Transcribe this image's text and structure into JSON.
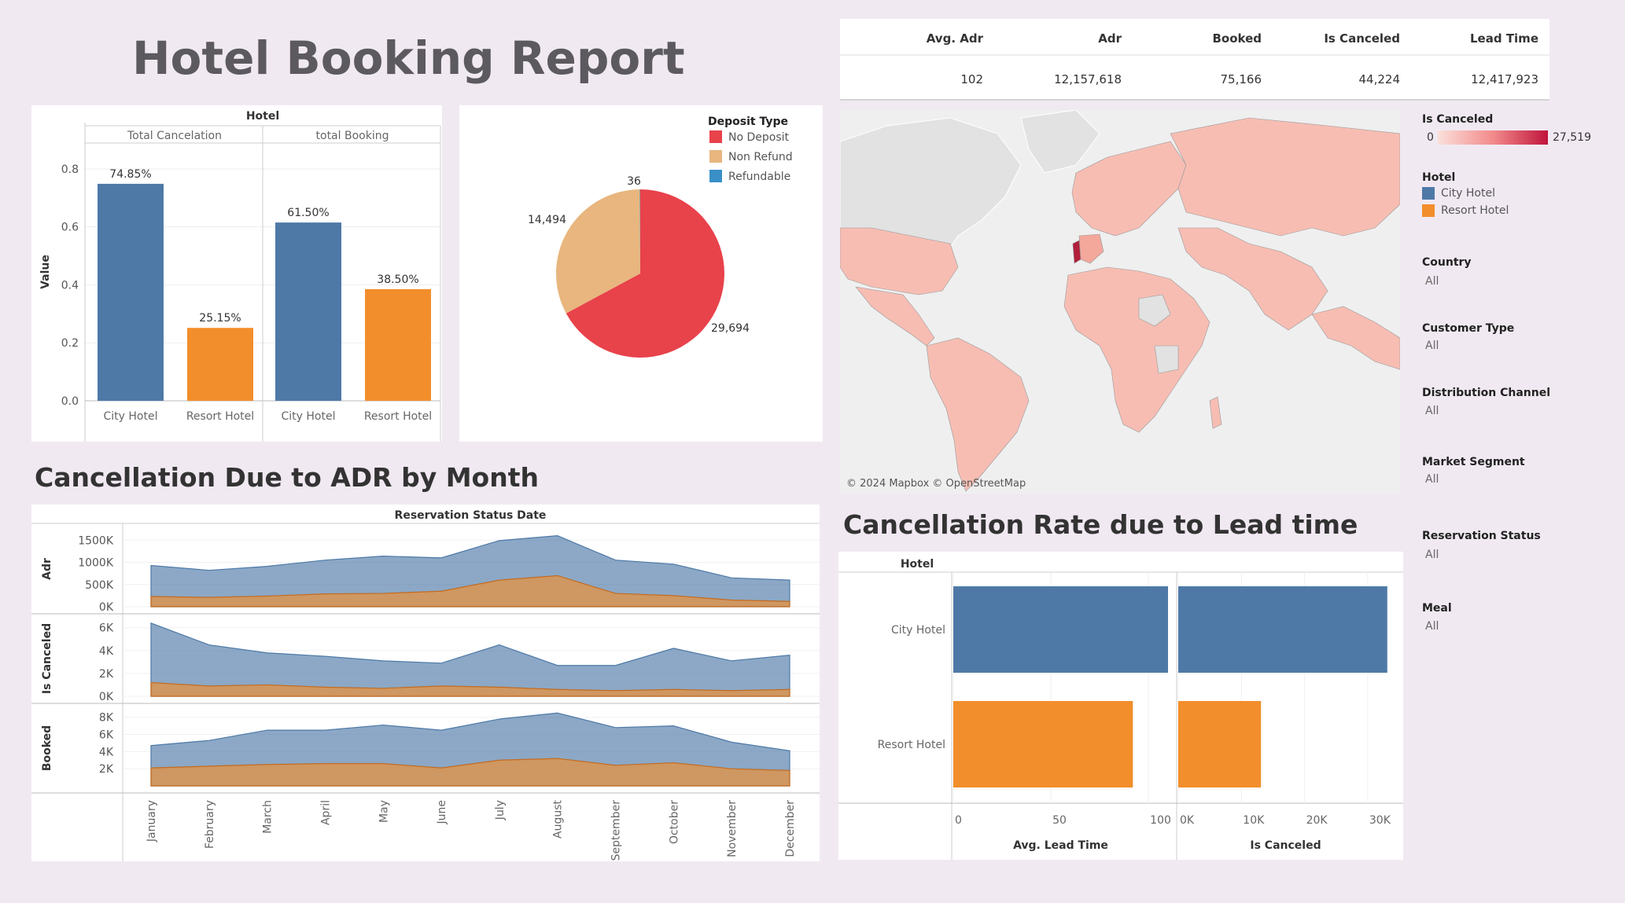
{
  "page_title": "Hotel Booking Report",
  "sections": {
    "adr_title": "Cancellation Due to ADR by Month",
    "lead_title": "Cancellation Rate due to Lead time"
  },
  "colors": {
    "city": "#4e79a7",
    "resort": "#f28e2b",
    "no_deposit": "#e8424b",
    "non_refund": "#e8b67e",
    "refundable": "#3a8fc6",
    "background": "#f1e9f2"
  },
  "kpi": {
    "headers": [
      "Avg. Adr",
      "Adr",
      "Booked",
      "Is Canceled",
      "Lead Time"
    ],
    "values": [
      "102",
      "12,157,618",
      "75,166",
      "44,224",
      "12,417,923"
    ]
  },
  "map": {
    "credit": "© 2024 Mapbox © OpenStreetMap",
    "legend_title": "Is Canceled",
    "legend_min": "0",
    "legend_max": "27,519"
  },
  "hotel_legend": {
    "title": "Hotel",
    "items": [
      "City Hotel",
      "Resort Hotel"
    ]
  },
  "filters": [
    {
      "label": "Country",
      "value": "All"
    },
    {
      "label": "Customer Type",
      "value": "All"
    },
    {
      "label": "Distribution Channel",
      "value": "All"
    },
    {
      "label": "Market Segment",
      "value": "All"
    },
    {
      "label": "Reservation Status",
      "value": "All"
    },
    {
      "label": "Meal",
      "value": "All"
    }
  ],
  "chart_data": [
    {
      "id": "hotel_bars",
      "type": "bar",
      "title": "Hotel",
      "ylabel": "Value",
      "ylim": [
        0,
        0.9
      ],
      "yticks": [
        "0.8",
        "0.6",
        "0.4",
        "0.2",
        "0.0"
      ],
      "panels": [
        {
          "name": "Total Cancelation",
          "categories": [
            "City Hotel",
            "Resort Hotel"
          ],
          "values": [
            0.7485,
            0.2515
          ],
          "labels": [
            "74.85%",
            "25.15%"
          ]
        },
        {
          "name": "total Booking",
          "categories": [
            "City Hotel",
            "Resort Hotel"
          ],
          "values": [
            0.615,
            0.385
          ],
          "labels": [
            "61.50%",
            "38.50%"
          ]
        }
      ]
    },
    {
      "id": "deposit_pie",
      "type": "pie",
      "legend_title": "Deposit Type",
      "categories": [
        "No Deposit",
        "Non Refund",
        "Refundable"
      ],
      "values": [
        29694,
        14494,
        36
      ],
      "labels": [
        "29,694",
        "14,494",
        "36"
      ]
    },
    {
      "id": "monthly_area",
      "type": "area",
      "title": "Reservation Status Date",
      "categories": [
        "January",
        "February",
        "March",
        "April",
        "May",
        "June",
        "July",
        "August",
        "September",
        "October",
        "November",
        "December"
      ],
      "rows": [
        {
          "name": "Adr",
          "ylim": [
            0,
            1700000
          ],
          "yticks": [
            [
              0,
              "0K"
            ],
            [
              500000,
              "500K"
            ],
            [
              1000000,
              "1000K"
            ],
            [
              1500000,
              "1500K"
            ]
          ],
          "city": [
            930000,
            820000,
            910000,
            1050000,
            1140000,
            1100000,
            1490000,
            1600000,
            1050000,
            960000,
            650000,
            600000
          ],
          "resort": [
            230000,
            210000,
            240000,
            290000,
            300000,
            350000,
            600000,
            700000,
            300000,
            250000,
            150000,
            120000
          ]
        },
        {
          "name": "Is Canceled",
          "ylim": [
            0,
            6600
          ],
          "yticks": [
            [
              0,
              "0K"
            ],
            [
              2000,
              "2K"
            ],
            [
              4000,
              "4K"
            ],
            [
              6000,
              "6K"
            ]
          ],
          "city": [
            6400,
            4500,
            3800,
            3500,
            3100,
            2900,
            4500,
            2700,
            2700,
            4200,
            3100,
            3600
          ],
          "resort": [
            1200,
            900,
            1000,
            800,
            700,
            900,
            800,
            600,
            500,
            600,
            500,
            600
          ],
          "lower": [
            0,
            0,
            0,
            0,
            0,
            0,
            0,
            0,
            0,
            0,
            0,
            0
          ]
        },
        {
          "name": "Booked",
          "ylim": [
            0,
            8800
          ],
          "yticks": [
            [
              2000,
              "2K"
            ],
            [
              4000,
              "4K"
            ],
            [
              6000,
              "6K"
            ],
            [
              8000,
              "8K"
            ]
          ],
          "city": [
            4700,
            5300,
            6500,
            6500,
            7100,
            6500,
            7800,
            8500,
            6800,
            7000,
            5100,
            4100
          ],
          "resort": [
            2100,
            2300,
            2500,
            2600,
            2600,
            2100,
            3000,
            3200,
            2400,
            2700,
            2000,
            1800
          ]
        }
      ]
    },
    {
      "id": "lead_bars",
      "type": "bar",
      "orientation": "horizontal",
      "title": "Hotel",
      "categories": [
        "City Hotel",
        "Resort Hotel"
      ],
      "panels": [
        {
          "name": "Avg. Lead Time",
          "xlim": [
            0,
            110
          ],
          "xticks": [
            [
              0,
              "0"
            ],
            [
              50,
              "50"
            ],
            [
              100,
              "100"
            ]
          ],
          "values": [
            110,
            92
          ]
        },
        {
          "name": "Is Canceled",
          "xlim": [
            0,
            34000
          ],
          "xticks": [
            [
              0,
              "0K"
            ],
            [
              10000,
              "10K"
            ],
            [
              20000,
              "20K"
            ],
            [
              30000,
              "30K"
            ]
          ],
          "values": [
            33100,
            13100
          ]
        }
      ]
    }
  ]
}
